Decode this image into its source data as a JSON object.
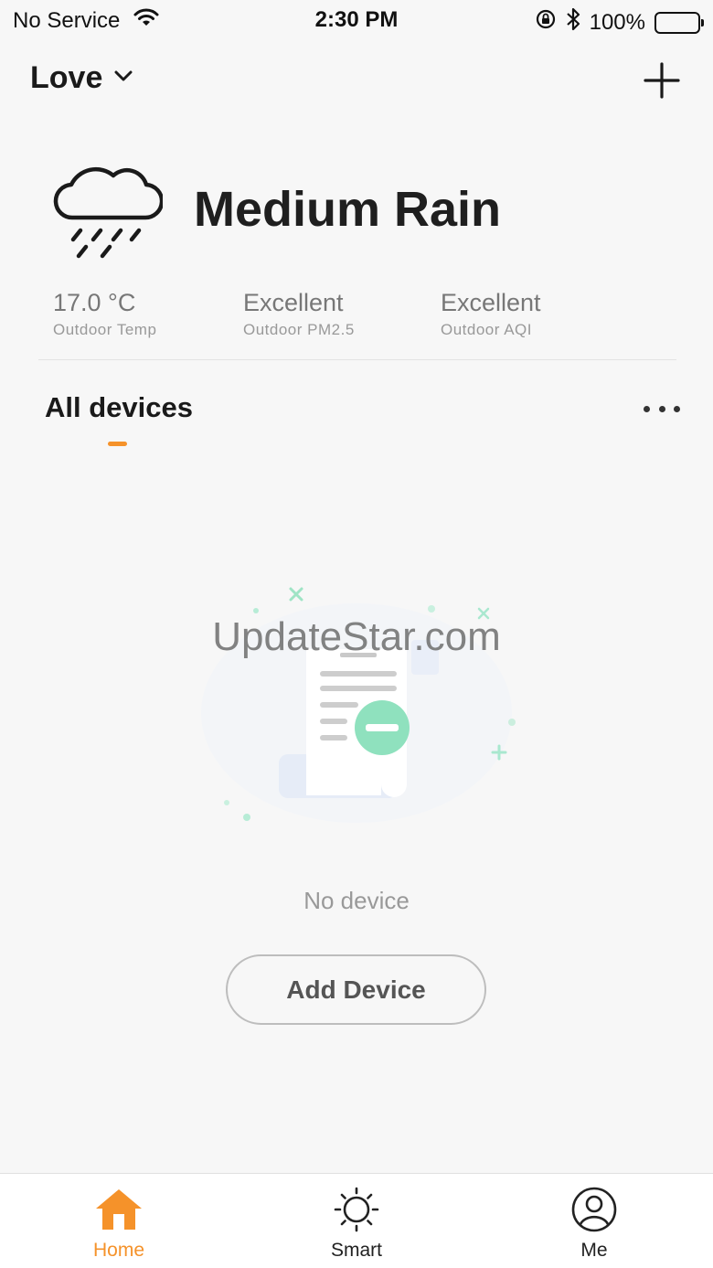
{
  "status_bar": {
    "carrier": "No Service",
    "time": "2:30 PM",
    "battery": "100%"
  },
  "header": {
    "home_name": "Love"
  },
  "weather": {
    "condition": "Medium Rain",
    "stats": [
      {
        "value": "17.0 °C",
        "label": "Outdoor Temp"
      },
      {
        "value": "Excellent",
        "label": "Outdoor PM2.5"
      },
      {
        "value": "Excellent",
        "label": "Outdoor AQI"
      }
    ]
  },
  "devices": {
    "tab_label": "All devices",
    "empty_text": "No device",
    "add_button": "Add Device"
  },
  "watermark": "UpdateStar.com",
  "tabbar": {
    "items": [
      {
        "label": "Home",
        "icon": "home-icon",
        "active": true
      },
      {
        "label": "Smart",
        "icon": "sun-icon",
        "active": false
      },
      {
        "label": "Me",
        "icon": "user-icon",
        "active": false
      }
    ]
  },
  "colors": {
    "accent": "#f5922a",
    "illustration_green": "#7fdcb0"
  }
}
